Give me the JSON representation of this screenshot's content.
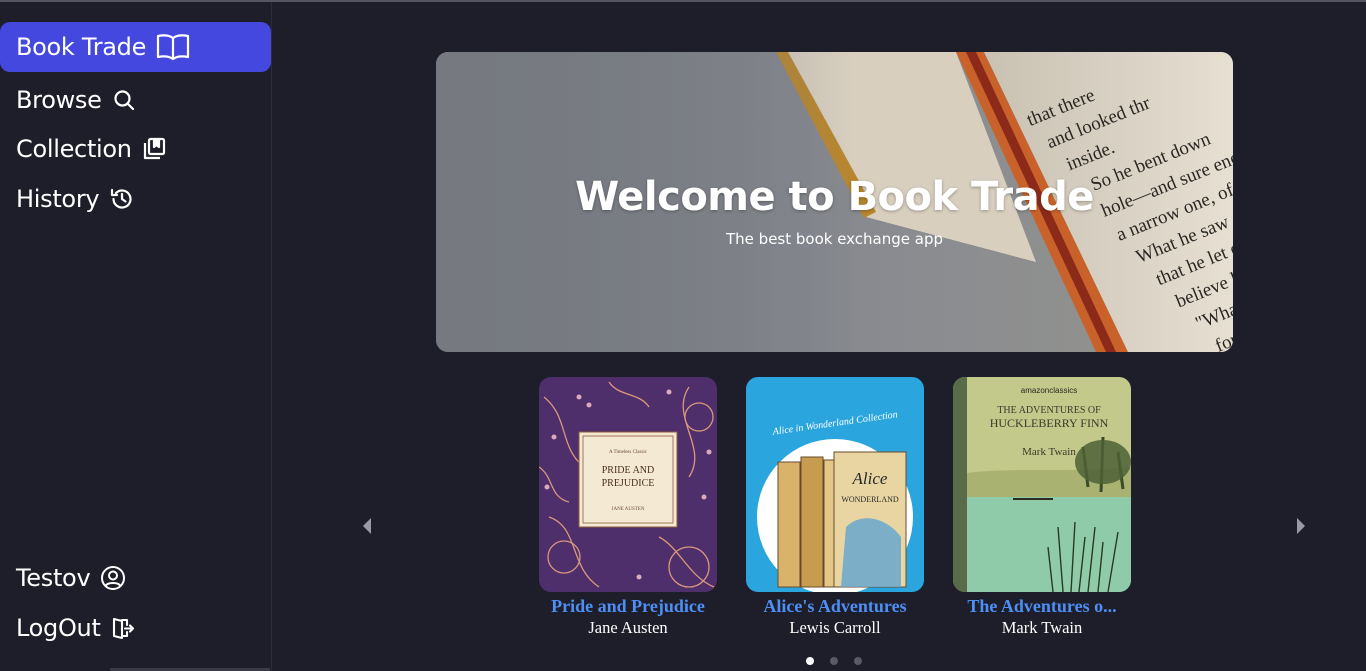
{
  "sidebar": {
    "brand": {
      "label": "Book Trade",
      "icon": "open-book-icon"
    },
    "items": [
      {
        "label": "Browse",
        "icon": "search-icon"
      },
      {
        "label": "Collection",
        "icon": "collection-icon"
      },
      {
        "label": "History",
        "icon": "history-icon"
      }
    ],
    "user": {
      "label": "Testov",
      "icon": "user-circle-icon"
    },
    "logout": {
      "label": "LogOut",
      "icon": "logout-icon"
    }
  },
  "hero": {
    "title": "Welcome to Book Trade",
    "subtitle": "The best book exchange app"
  },
  "carousel": {
    "books": [
      {
        "title": "Pride and Prejudice",
        "author": "Jane Austen",
        "cover": {
          "series": "A Timeless Classic",
          "title_line1": "PRIDE AND",
          "title_line2": "PREJUDICE",
          "author": "JANE AUSTEN"
        }
      },
      {
        "title": "Alice's Adventures",
        "author": "Lewis Carroll",
        "cover": {
          "banner": "Alice in Wonderland Collection",
          "book_title_line1": "Alice",
          "book_title_line2": "WONDERLAND"
        }
      },
      {
        "title": "The Adventures o...",
        "author": "Mark Twain",
        "cover": {
          "publisher": "amazonclassics",
          "title_line1": "THE ADVENTURES OF",
          "title_line2": "HUCKLEBERRY FINN",
          "author": "Mark Twain"
        }
      }
    ],
    "pages": 3,
    "active_page": 1
  },
  "colors": {
    "background": "#1e1e2a",
    "accent": "#4448df",
    "link": "#4d8ff5"
  }
}
